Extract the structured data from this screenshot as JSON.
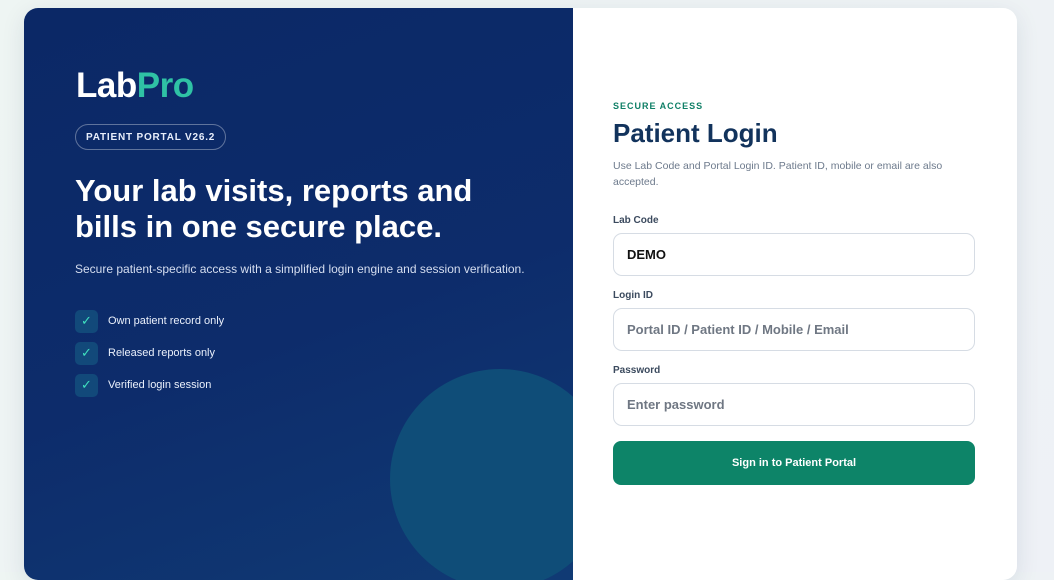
{
  "brand": {
    "lab": "Lab",
    "pro": "Pro"
  },
  "left": {
    "badge": "PATIENT PORTAL V26.2",
    "headline": "Your lab visits, reports and bills in one secure place.",
    "subtext": "Secure patient-specific access with a simplified login engine and session verification.",
    "features": [
      {
        "icon": "check-icon",
        "glyph": "✓",
        "label": "Own patient record only"
      },
      {
        "icon": "check-icon",
        "glyph": "✓",
        "label": "Released reports only"
      },
      {
        "icon": "check-icon",
        "glyph": "✓",
        "label": "Verified login session"
      }
    ]
  },
  "login": {
    "eyebrow": "SECURE ACCESS",
    "title": "Patient Login",
    "help": "Use Lab Code and Portal Login ID. Patient ID, mobile or email are also accepted.",
    "lab_code": {
      "label": "Lab Code",
      "value": "DEMO"
    },
    "login_id": {
      "label": "Login ID",
      "placeholder": "Portal ID / Patient ID / Mobile / Email"
    },
    "password": {
      "label": "Password",
      "placeholder": "Enter password"
    },
    "submit_label": "Sign in to Patient Portal"
  },
  "colors": {
    "panel": "#0b2866",
    "accent": "#2fc2a5",
    "button": "#0d8468",
    "title": "#12335c"
  }
}
